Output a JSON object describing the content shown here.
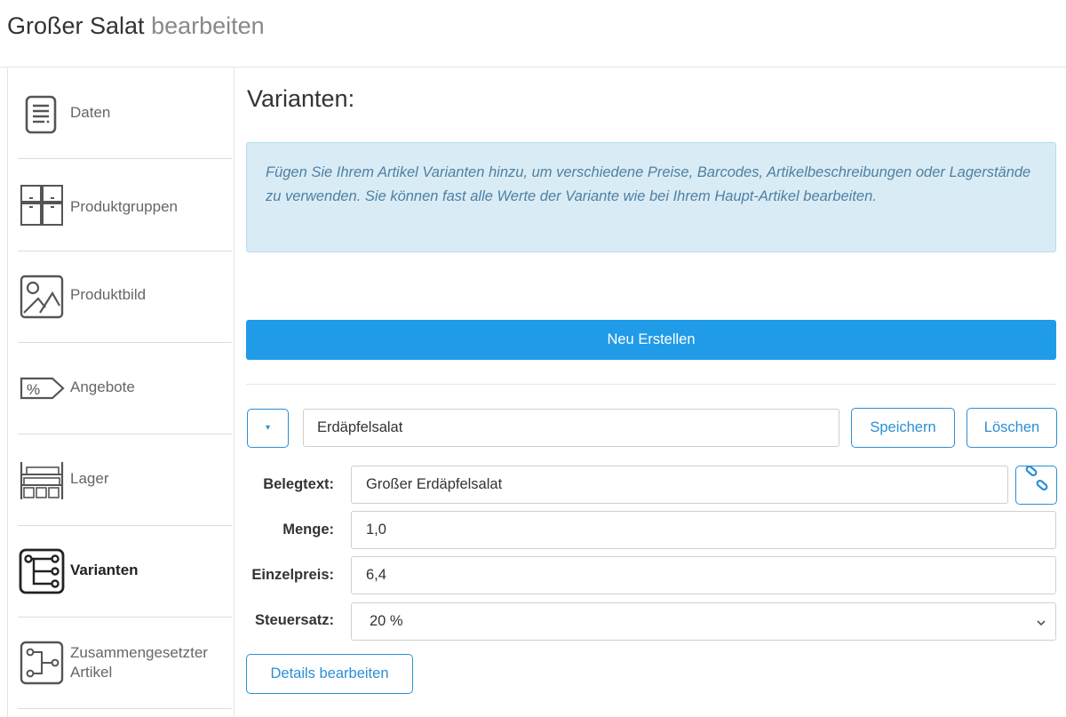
{
  "header": {
    "title": "Großer Salat",
    "subtitle": "bearbeiten"
  },
  "sidebar": {
    "items": [
      {
        "label": "Daten",
        "icon": "document-icon",
        "active": false
      },
      {
        "label": "Produktgruppen",
        "icon": "product-groups-icon",
        "active": false
      },
      {
        "label": "Produktbild",
        "icon": "image-icon",
        "active": false
      },
      {
        "label": "Angebote",
        "icon": "percent-tag-icon",
        "active": false
      },
      {
        "label": "Lager",
        "icon": "shelf-icon",
        "active": false
      },
      {
        "label": "Varianten",
        "icon": "variants-tree-icon",
        "active": true
      },
      {
        "label": "Zusammengesetzter Artikel",
        "icon": "composite-item-icon",
        "active": false
      }
    ]
  },
  "main": {
    "section_title": "Varianten:",
    "info_text": "Fügen Sie Ihrem Artikel Varianten hinzu, um verschiedene Preise, Barcodes, Artikelbeschreibungen oder Lagerstände zu verwenden. Sie können fast alle Werte der Variante wie bei Ihrem Haupt-Artikel bearbeiten.",
    "new_button": "Neu Erstellen",
    "variant": {
      "toggle_symbol": "▾",
      "name": "Erdäpfelsalat",
      "save_label": "Speichern",
      "delete_label": "Löschen",
      "fields": {
        "belegtext": {
          "label": "Belegtext:",
          "value": "Großer Erdäpfelsalat"
        },
        "menge": {
          "label": "Menge:",
          "value": "1,0"
        },
        "einzelpreis": {
          "label": "Einzelpreis:",
          "value": "6,4"
        },
        "steuersatz": {
          "label": "Steuersatz:",
          "value": "20 %"
        }
      },
      "details_button": "Details bearbeiten"
    }
  },
  "colors": {
    "primary": "#1f9be8",
    "outline": "#2b8ed4",
    "info_bg": "#d9ecf6",
    "info_text": "#4f7fa1"
  }
}
